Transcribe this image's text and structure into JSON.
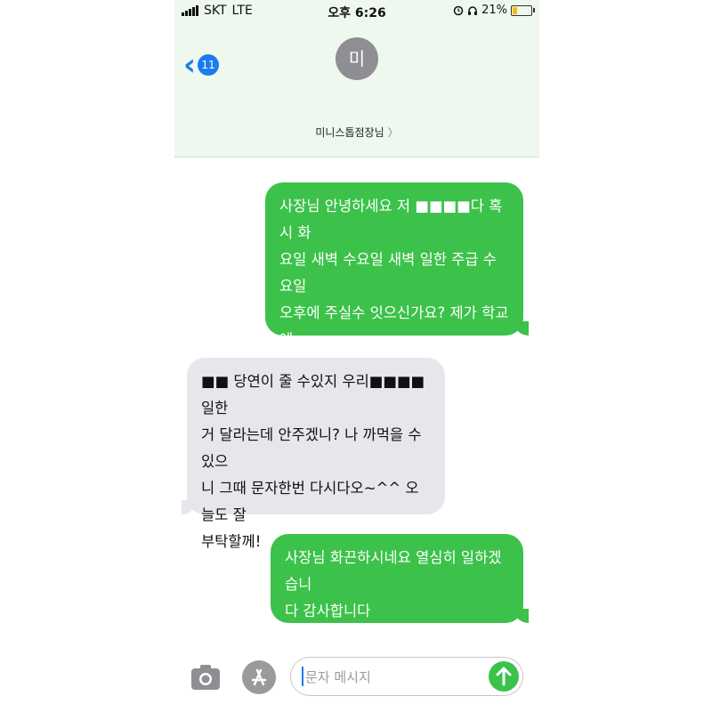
{
  "status_bar": {
    "carrier": "SKT",
    "network": "LTE",
    "time": "오후 6:26",
    "battery_percent": "21%",
    "battery_level": 0.21
  },
  "header": {
    "back_count": "11",
    "avatar_initial": "미",
    "contact_name": "미니스톱점장님",
    "contact_arrow": "〉"
  },
  "messages": [
    {
      "from": "me",
      "text": "사장님 안녕하세요 저 ■■■■다 혹시 화\n요일 새벽 수요일 새벽 일한 주급 수요일\n오후에 주실수 잇으신가요? 제가 학교에\n내야할 금액이 있어서요,,!"
    },
    {
      "from": "contact",
      "text": "■■ 당연이 줄 수있지 우리■■■■일한\n거 달라는데 안주겠니? 나 까먹을 수 있으\n니 그때 문자한번 다시다오~^^ 오늘도 잘\n부탁할께!"
    },
    {
      "from": "me",
      "text": "사장님 화끈하시네요 열심히 일하겠습니\n다 감사합니다"
    }
  ],
  "input": {
    "placeholder": "문자 메시지",
    "value": ""
  },
  "colors": {
    "accent_blue": "#1a7cf0",
    "sent_bubble": "#3cc24a",
    "received_bubble": "#e6e6eb",
    "header_bg": "#eef8ee"
  },
  "icons": {
    "camera": "camera-icon",
    "app_store": "app-store-icon",
    "send": "send-arrow-icon",
    "back": "chevron-left-icon",
    "alarm": "alarm-icon",
    "headphones": "headphones-icon"
  }
}
